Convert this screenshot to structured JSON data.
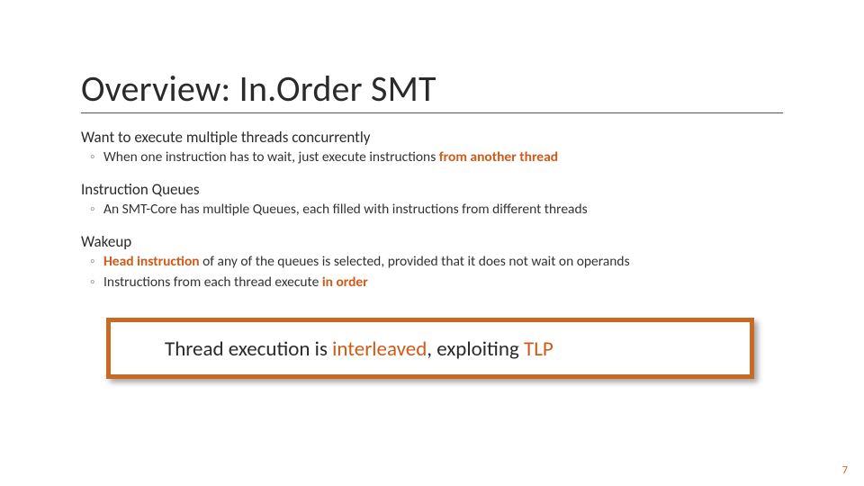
{
  "title": "Overview: In.Order SMT",
  "sections": {
    "s1": {
      "heading": "Want to execute multiple threads concurrently",
      "b1_pre": "When one instruction has to wait, just execute instructions ",
      "b1_hl": "from another thread"
    },
    "s2": {
      "heading": "Instruction Queues",
      "b1": "An SMT-Core has multiple Queues, each filled with instructions from different threads"
    },
    "s3": {
      "heading": "Wakeup",
      "b1_hl": "Head instruction",
      "b1_post": " of any of the queues is selected, provided that it does not wait on operands",
      "b2_pre": "Instructions from each thread execute ",
      "b2_hl": "in order"
    }
  },
  "callout": {
    "t1": "Thread execution is ",
    "t2": "interleaved",
    "t3": ", exploiting ",
    "t4": "TLP"
  },
  "bullet_marker": "◦",
  "page_number": "7"
}
